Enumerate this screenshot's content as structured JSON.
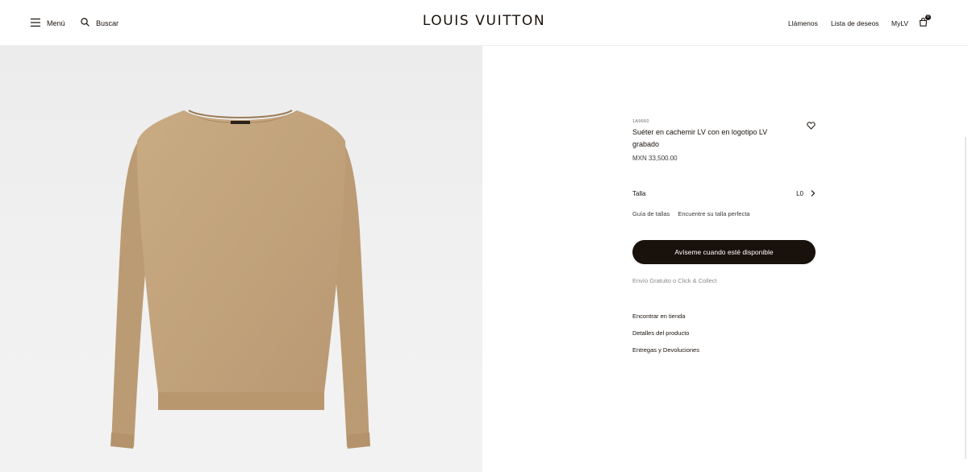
{
  "header": {
    "menu_label": "Menú",
    "search_label": "Buscar",
    "logo": "LOUIS VUITTON",
    "call_label": "Llámenos",
    "wishlist_label": "Lista de deseos",
    "account_label": "MyLV",
    "cart_count": "0"
  },
  "product": {
    "sku": "1A9660",
    "title": "Suéter en cachemir LV con en logotipo LV grabado",
    "price": "MXN 33,500.00",
    "image_color": "#c4a57c",
    "size_label": "Talla",
    "size_value": "L0",
    "size_guide_label": "Guía de tallas",
    "size_finder_label": "Encuentre su talla perfecta",
    "cta_label": "Avíseme cuando esté disponible",
    "shipping_note": "Envío Gratuito o Click & Collect",
    "links": [
      "Encontrar en tienda",
      "Detalles del producto",
      "Entregas y Devoluciones"
    ]
  }
}
